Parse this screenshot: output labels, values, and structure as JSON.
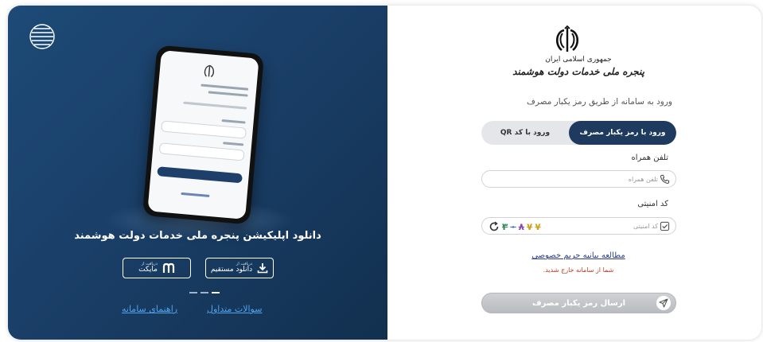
{
  "promo": {
    "title": "دانلود اپلیکیشن پنجره ملی خدمات دولت هوشمند",
    "download_direct_small": "دریافت از",
    "download_direct_label": "دانلود مستقیم",
    "download_myket_small": "دریافت از",
    "download_myket_label": "مایکت",
    "faq_link": "سوالات متداول",
    "guide_link": "راهنمای سامانه",
    "slider": {
      "count": 3,
      "active_index": 2
    }
  },
  "login": {
    "brand_line1": "جمهوری اسلامی ایران",
    "brand_line2": "پنجره ملی خدمات دولت هوشمند",
    "subtitle": "ورود به سامانه از طریق رمز یکبار مصرف",
    "tabs": [
      {
        "label": "ورود با رمز یکبار مصرف",
        "active": true
      },
      {
        "label": "ورود با کد QR",
        "active": false
      }
    ],
    "phone_label": "تلفن همراه",
    "phone_placeholder": "تلفن همراه",
    "captcha_label": "کد امنیتی",
    "captcha_placeholder": "کد امنیتی",
    "captcha_chars": [
      "۳",
      "۰",
      "۸",
      "۷",
      "۷"
    ],
    "privacy_link": "مطالعه بیانیه حریم خصوصی",
    "logout_message": "شما از سامانه خارج شدید.",
    "send_button": "ارسال رمز یکبار مصرف"
  },
  "colors": {
    "panel_blue": "#1b4370",
    "tab_active": "#1e3a5f",
    "link_blue": "#53a3ec",
    "error_red": "#c0392b"
  }
}
